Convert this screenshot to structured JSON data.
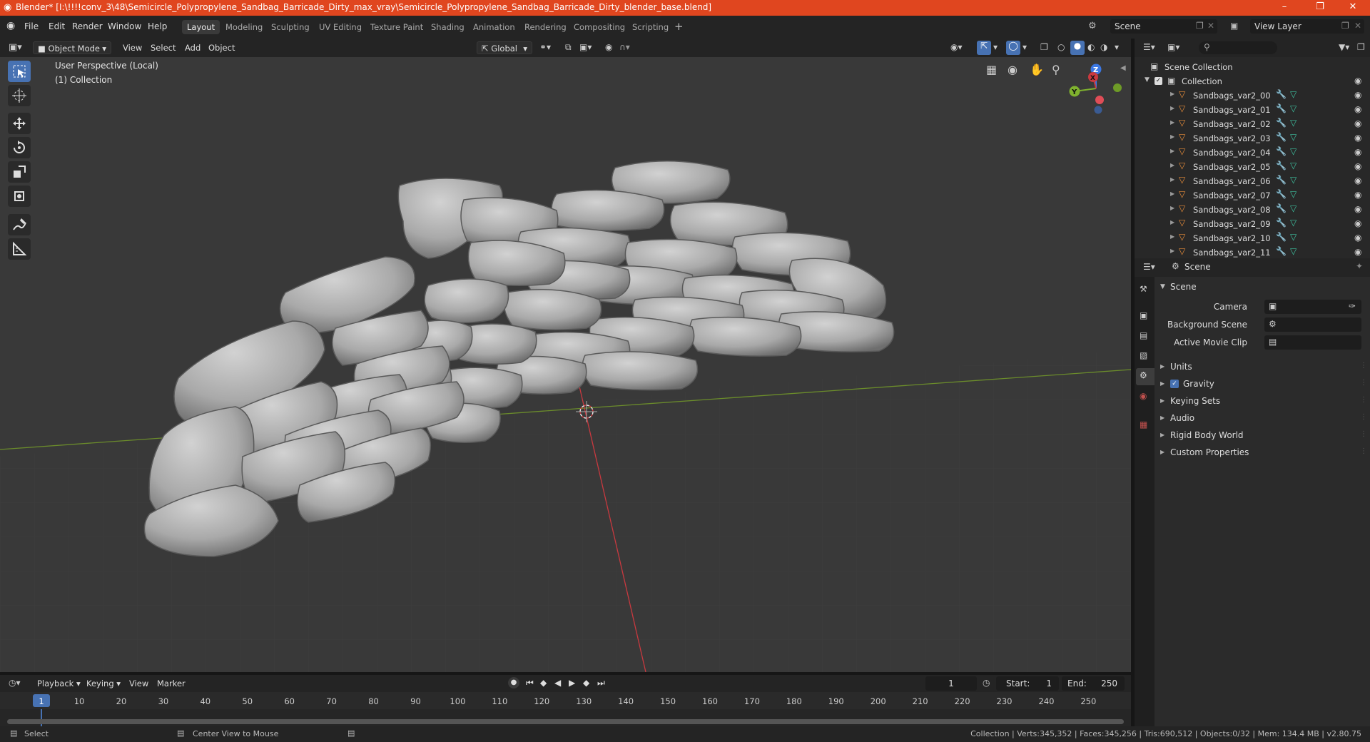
{
  "window": {
    "title": "Blender* [I:\\!!!!conv_3\\48\\Semicircle_Polypropylene_Sandbag_Barricade_Dirty_max_vray\\Semicircle_Polypropylene_Sandbag_Barricade_Dirty_blender_base.blend]"
  },
  "menu": {
    "items": [
      "File",
      "Edit",
      "Render",
      "Window",
      "Help"
    ]
  },
  "workspaces": [
    "Layout",
    "Modeling",
    "Sculpting",
    "UV Editing",
    "Texture Paint",
    "Shading",
    "Animation",
    "Rendering",
    "Compositing",
    "Scripting"
  ],
  "topbar": {
    "scene": "Scene",
    "view_layer": "View Layer",
    "add": "+"
  },
  "viewport_header": {
    "mode": "Object Mode",
    "menus": [
      "View",
      "Select",
      "Add",
      "Object"
    ],
    "orientation": "Global"
  },
  "viewport": {
    "perspective": "User Perspective (Local)",
    "collection": "(1) Collection",
    "gizmo": {
      "x": "X",
      "y": "Y",
      "z": "Z"
    }
  },
  "outliner": {
    "root": "Scene Collection",
    "collection": "Collection",
    "objects": [
      "Sandbags_var2_00",
      "Sandbags_var2_01",
      "Sandbags_var2_02",
      "Sandbags_var2_03",
      "Sandbags_var2_04",
      "Sandbags_var2_05",
      "Sandbags_var2_06",
      "Sandbags_var2_07",
      "Sandbags_var2_08",
      "Sandbags_var2_09",
      "Sandbags_var2_10",
      "Sandbags_var2_11"
    ]
  },
  "properties": {
    "context": "Scene",
    "panel": "Scene",
    "camera_label": "Camera",
    "background_scene_label": "Background Scene",
    "active_movie_clip_label": "Active Movie Clip",
    "sections": [
      "Units",
      "Gravity",
      "Keying Sets",
      "Audio",
      "Rigid Body World",
      "Custom Properties"
    ],
    "gravity_checked": true
  },
  "timeline": {
    "menus": [
      "Playback",
      "Keying",
      "View",
      "Marker"
    ],
    "current_frame": "1",
    "start_label": "Start:",
    "start": "1",
    "end_label": "End:",
    "end": "250",
    "ticks": [
      "1",
      "10",
      "20",
      "30",
      "40",
      "50",
      "60",
      "70",
      "80",
      "90",
      "100",
      "110",
      "120",
      "130",
      "140",
      "150",
      "160",
      "170",
      "180",
      "190",
      "200",
      "210",
      "220",
      "230",
      "240",
      "250"
    ]
  },
  "status": {
    "select": "Select",
    "center_view": "Center View to Mouse",
    "stats": "Collection | Verts:345,352 | Faces:345,256 | Tris:690,512 | Objects:0/32 | Mem: 134.4 MB | v2.80.75"
  },
  "colors": {
    "title_bar": "#e0461f",
    "accent": "#4772b3",
    "x_axis": "#c9393f",
    "y_axis": "#7fb22e",
    "z_axis": "#3b78e4"
  }
}
